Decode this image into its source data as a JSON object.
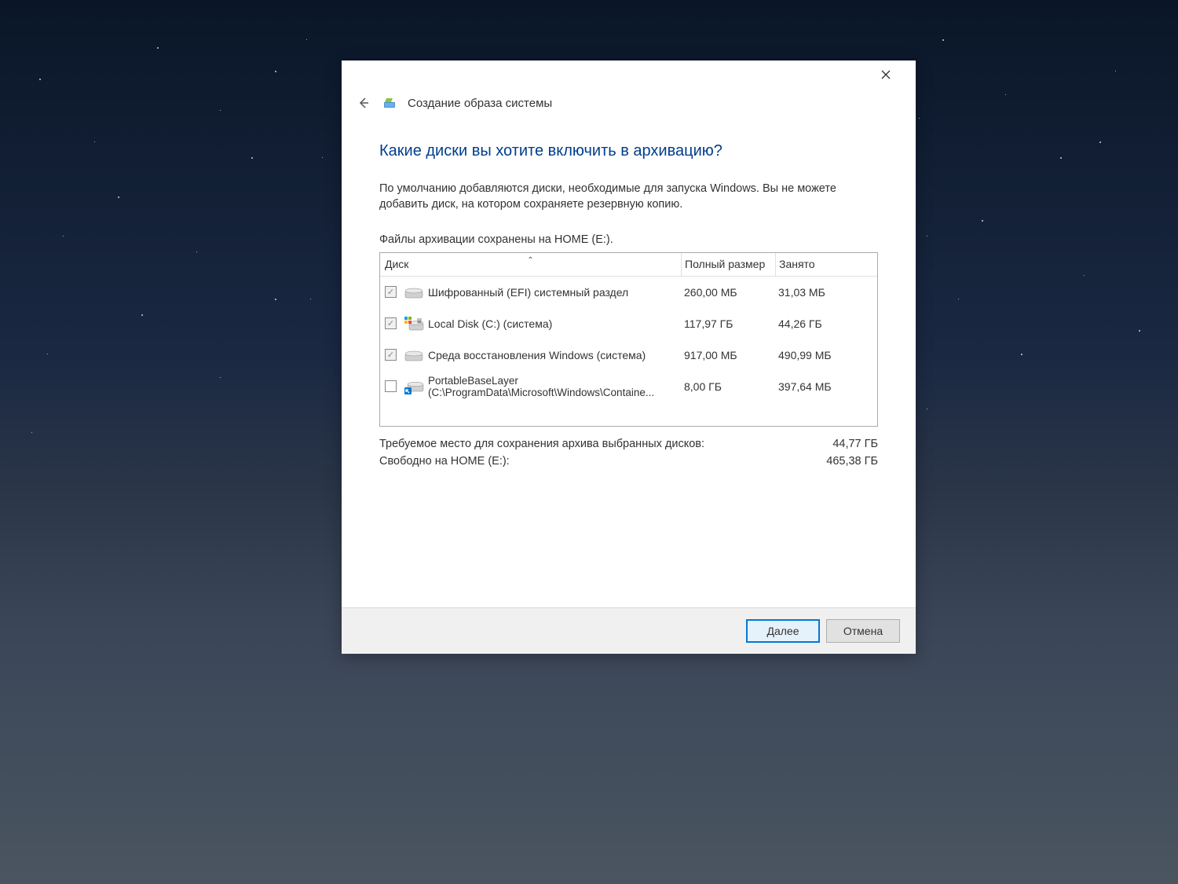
{
  "window": {
    "title": "Создание образа системы"
  },
  "heading": "Какие диски вы хотите включить в архивацию?",
  "description": "По умолчанию добавляются диски, необходимые для запуска Windows. Вы не можете добавить диск, на котором сохраняете резервную копию.",
  "save_location": "Файлы архивации сохранены на HOME (E:).",
  "table": {
    "headers": {
      "disk": "Диск",
      "size": "Полный размер",
      "used": "Занято"
    },
    "rows": [
      {
        "name": "Шифрованный (EFI) системный раздел",
        "sub": "",
        "size": "260,00 МБ",
        "used": "31,03 МБ",
        "checked": true,
        "disabled": true,
        "icon": "disk"
      },
      {
        "name": "Local Disk (C:) (система)",
        "sub": "",
        "size": "117,97 ГБ",
        "used": "44,26 ГБ",
        "checked": true,
        "disabled": true,
        "icon": "windisk"
      },
      {
        "name": "Среда восстановления Windows (система)",
        "sub": "",
        "size": "917,00 МБ",
        "used": "490,99 МБ",
        "checked": true,
        "disabled": true,
        "icon": "disk"
      },
      {
        "name": "PortableBaseLayer",
        "sub": "(C:\\ProgramData\\Microsoft\\Windows\\Containe...",
        "size": "8,00 ГБ",
        "used": "397,64 МБ",
        "checked": false,
        "disabled": false,
        "icon": "linkdisk"
      }
    ]
  },
  "summary": {
    "required_label": "Требуемое место для сохранения архива выбранных дисков:",
    "required_value": "44,77 ГБ",
    "free_label": "Свободно на HOME (E:):",
    "free_value": "465,38 ГБ"
  },
  "buttons": {
    "next": "Далее",
    "cancel": "Отмена"
  }
}
